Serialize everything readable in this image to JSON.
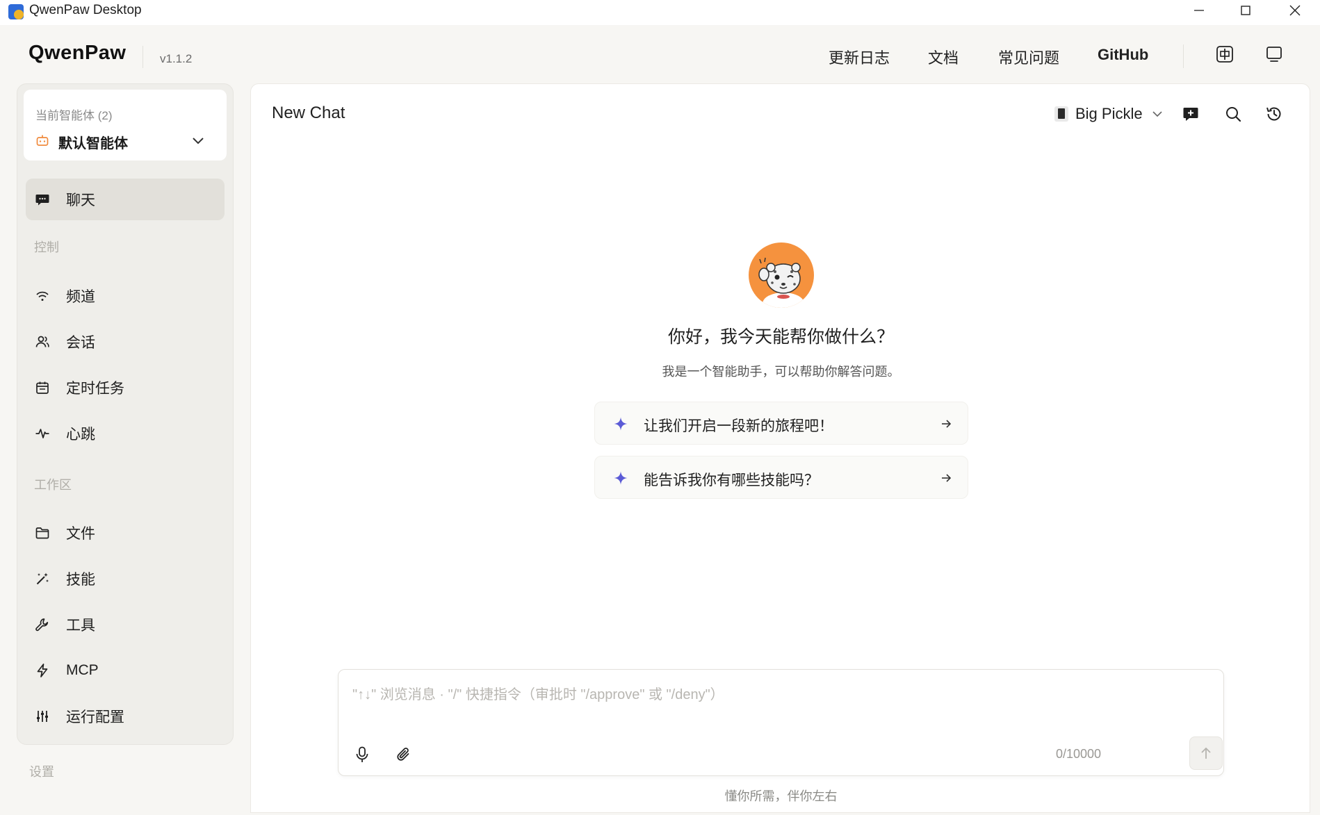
{
  "window": {
    "title": "QwenPaw Desktop",
    "controls": [
      "minimize-icon",
      "maximize-icon",
      "close-icon"
    ]
  },
  "header": {
    "logo": "QwenPaw",
    "version": "v1.1.2",
    "nav": [
      {
        "label": "更新日志"
      },
      {
        "label": "文档"
      },
      {
        "label": "常见问题"
      },
      {
        "label": "GitHub"
      }
    ],
    "icons": [
      "language-icon",
      "monitor-icon"
    ]
  },
  "sidebar": {
    "agent_caption": "当前智能体 (2)",
    "agent_name": "默认智能体",
    "chat_label": "聊天",
    "section_control": "控制",
    "control_items": [
      {
        "label": "频道",
        "icon": "wifi-icon"
      },
      {
        "label": "会话",
        "icon": "users-icon"
      },
      {
        "label": "定时任务",
        "icon": "calendar-icon"
      },
      {
        "label": "心跳",
        "icon": "pulse-icon"
      }
    ],
    "section_workspace": "工作区",
    "workspace_items": [
      {
        "label": "文件",
        "icon": "folder-icon"
      },
      {
        "label": "技能",
        "icon": "magic-wand-icon"
      },
      {
        "label": "工具",
        "icon": "wrench-icon"
      },
      {
        "label": "MCP",
        "icon": "lightning-icon"
      },
      {
        "label": "运行配置",
        "icon": "sliders-icon"
      }
    ],
    "settings_label": "设置"
  },
  "chat": {
    "title": "New Chat",
    "model": "Big Pickle",
    "toolbar_icons": [
      "new-chat-icon",
      "search-icon",
      "history-icon"
    ],
    "greeting": "你好，我今天能帮你做什么？",
    "subtitle": "我是一个智能助手，可以帮助你解答问题。",
    "prompts": [
      {
        "text": "让我们开启一段新的旅程吧！"
      },
      {
        "text": "能告诉我你有哪些技能吗？"
      }
    ],
    "input_placeholder": "\"↑↓\" 浏览消息 · \"/\" 快捷指令（审批时 \"/approve\" 或 \"/deny\"）",
    "input_value": "",
    "counter": "0/10000",
    "footer": "懂你所需，伴你左右"
  },
  "colors": {
    "page_bg": "#f7f6f3",
    "sidebar_bg": "#efeeea",
    "active_item_bg": "#e2e0da",
    "accent_spark": "#5b5bd6",
    "avatar_bg": "#f5923e"
  }
}
